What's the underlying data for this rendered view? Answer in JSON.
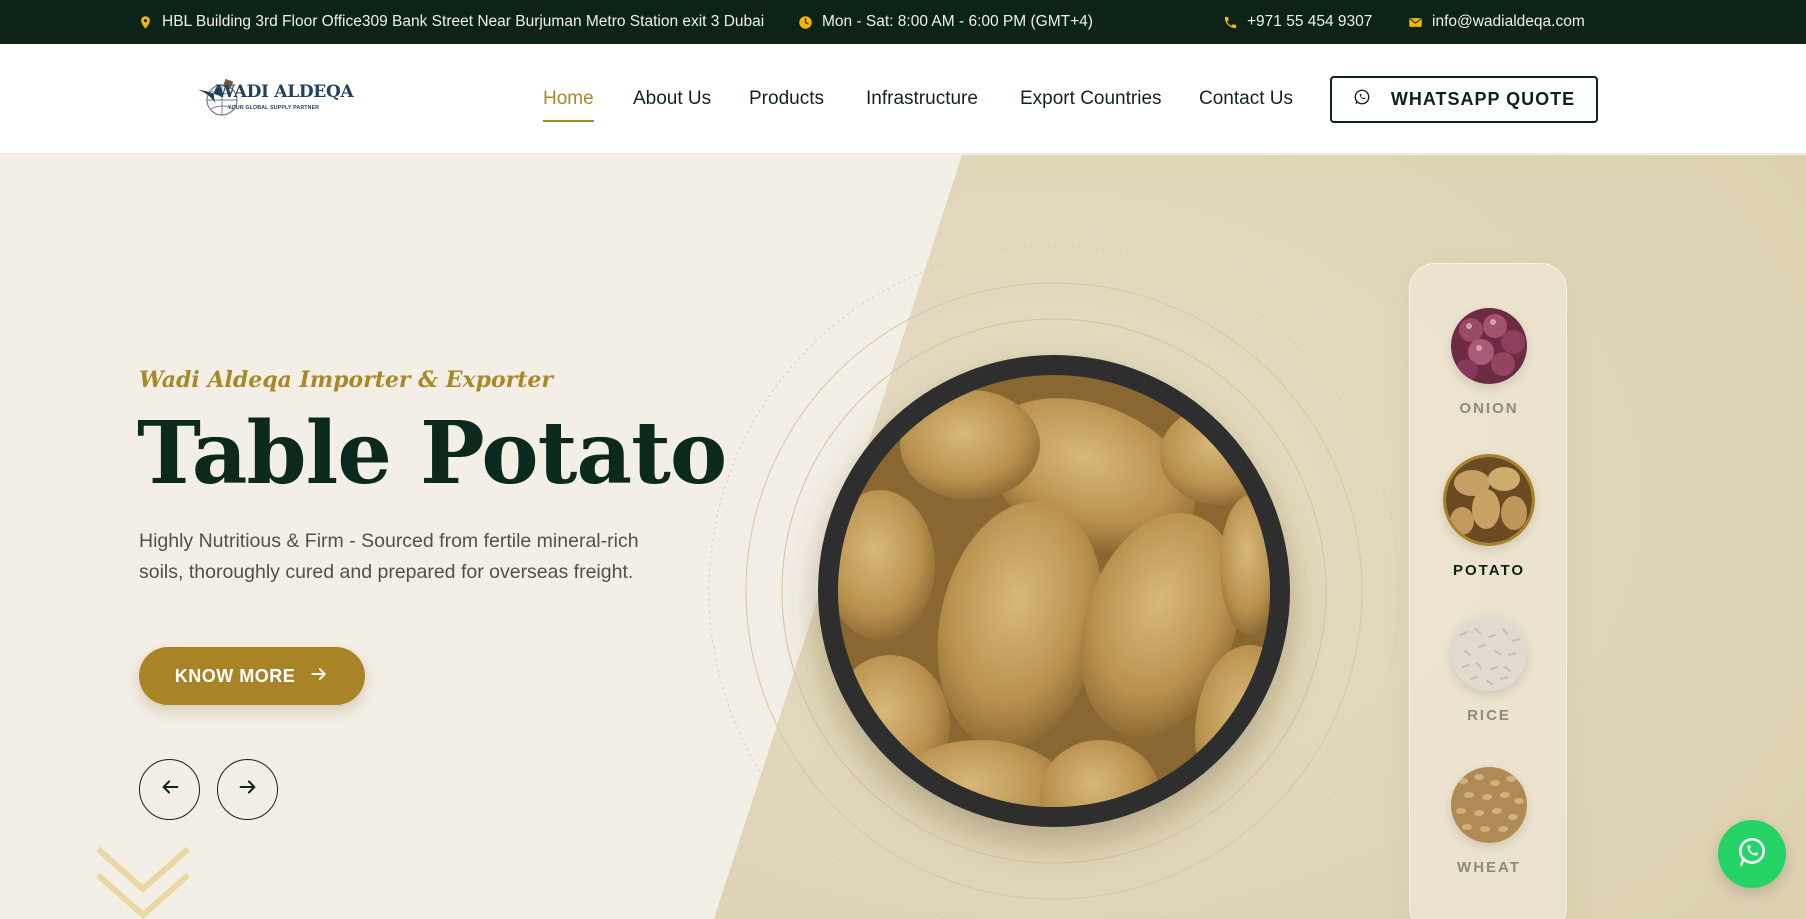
{
  "topbar": {
    "address": "HBL Building 3rd Floor Office309 Bank Street Near Burjuman Metro Station exit 3 Dubai",
    "hours": "Mon - Sat: 8:00 AM - 6:00 PM (GMT+4)",
    "phone": "+971 55 454 9307",
    "email": "info@wadialdeqa.com",
    "icon_color": "#f2b705"
  },
  "brand": {
    "name": "WADI ALDEQA",
    "tagline": "YOUR GLOBAL SUPPLY PARTNER"
  },
  "nav": {
    "items": [
      {
        "label": "Home",
        "active": true
      },
      {
        "label": "About Us"
      },
      {
        "label": "Products"
      },
      {
        "label": "Infrastructure"
      },
      {
        "label": "Export Countries"
      },
      {
        "label": "Contact Us"
      }
    ],
    "cta_label": "WHATSAPP QUOTE"
  },
  "hero": {
    "subtitle": "Wadi Aldeqa Importer & Exporter",
    "title": "Table Potato",
    "description": "Highly Nutritious & Firm - Sourced from fertile mineral-rich soils, thoroughly cured and prepared for overseas freight.",
    "button_label": "KNOW MORE"
  },
  "products": [
    {
      "label": "ONION",
      "icon": "onion-image"
    },
    {
      "label": "POTATO",
      "icon": "potato-image",
      "active": true
    },
    {
      "label": "RICE",
      "icon": "rice-image"
    },
    {
      "label": "WHEAT",
      "icon": "wheat-image"
    }
  ],
  "colors": {
    "dark_green": "#0c2418",
    "gold": "#a88427",
    "whatsapp_green": "#25d366"
  }
}
